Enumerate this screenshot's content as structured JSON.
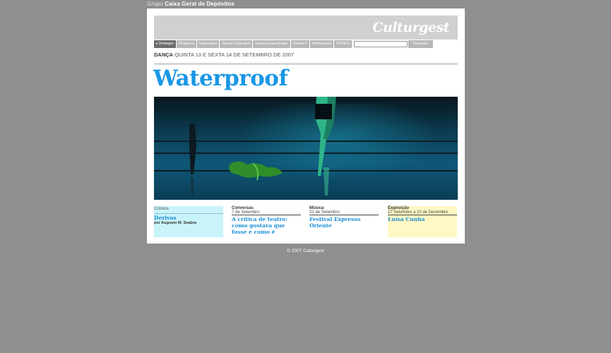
{
  "header": {
    "group_prefix": "Grupo",
    "group_name": "Caixa Geral de Depósitos",
    "logo": "Culturgest"
  },
  "nav": {
    "items": [
      {
        "label": "Destaque",
        "active": true
      },
      {
        "label": "Programa"
      },
      {
        "label": "Exposições"
      },
      {
        "label": "Serviço Educativo"
      },
      {
        "label": "Espaços para Alugar"
      },
      {
        "label": "Chiado 8"
      },
      {
        "label": "Informações"
      },
      {
        "label": "PRINOS"
      }
    ],
    "search_button": "Pesquisar",
    "search_value": ""
  },
  "event": {
    "category": "DANÇA",
    "dates": "QUINTA 13 E SEXTA 14 DE SETEMBRO DE 2007",
    "title": "Waterproof"
  },
  "columns": [
    {
      "category": "Crónica",
      "headline": "Derivas",
      "byline": "por Augusto M. Seabra"
    },
    {
      "category": "Conversas",
      "date": "7 de Setembro",
      "headline": "A crítica de teatro: como gostava que fosse e como é"
    },
    {
      "category": "Música",
      "date": "22 de Setembro",
      "headline": "Festival Expresso Oriente"
    },
    {
      "category": "Exposição",
      "date": "17 Setembro a 22 de Dezembro",
      "headline": "Luísa Cunha"
    }
  ],
  "footer": {
    "copyright": "© 2007 Culturgest"
  },
  "colors": {
    "accent": "#1997e6",
    "background": "#8f8f8f"
  }
}
